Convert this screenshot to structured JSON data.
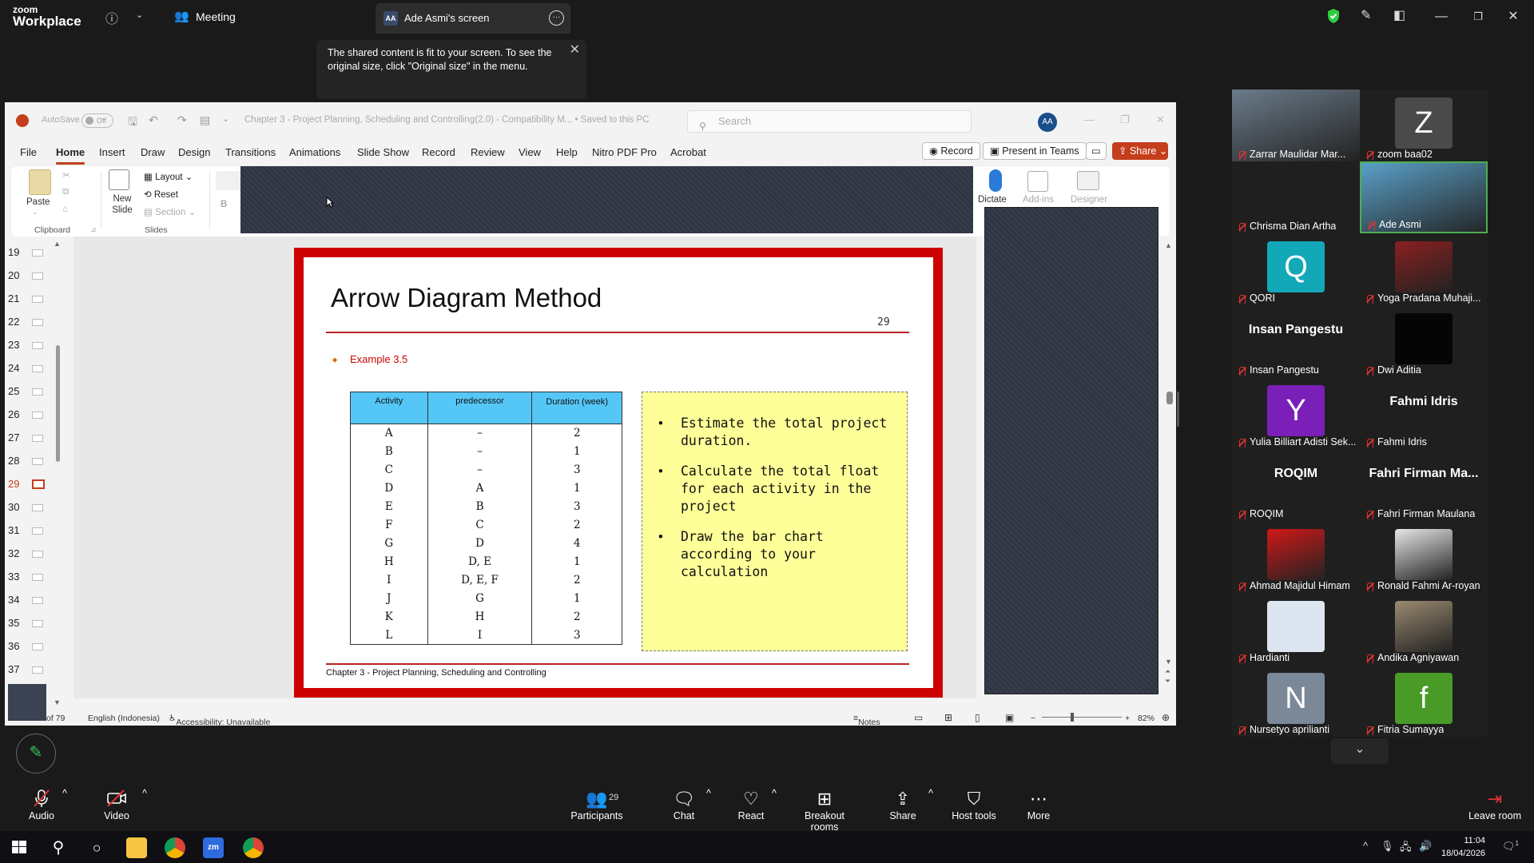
{
  "zoom": {
    "logo_line1": "zoom",
    "logo_line2": "Workplace",
    "meeting_label": "Meeting",
    "screen_tab_badge": "AA",
    "screen_tab_title": "Ade Asmi's screen",
    "tooltip_text": "The shared content is fit to your screen. To see the original size, click \"Original size\" in the menu."
  },
  "ppt": {
    "autosave_label": "AutoSave",
    "autosave_state": "Off",
    "doc_title": "Chapter 3 - Project Planning, Scheduling and Controlling(2.0) - Compatibility M... • Saved to this PC",
    "search_placeholder": "Search",
    "avatar": "AA",
    "tabs": [
      "File",
      "Home",
      "Insert",
      "Draw",
      "Design",
      "Transitions",
      "Animations",
      "Slide Show",
      "Record",
      "Review",
      "View",
      "Help",
      "Nitro PDF Pro",
      "Acrobat"
    ],
    "record_btn": "Record",
    "teams_btn": "Present in Teams",
    "share_btn": "Share",
    "ribbon": {
      "paste": "Paste",
      "clipboard": "Clipboard",
      "new_slide": "New Slide",
      "layout": "Layout",
      "reset": "Reset",
      "section": "Section",
      "slides": "Slides",
      "bold": "B",
      "dictate": "Dictate",
      "addins": "Add-ins",
      "designer": "Designer"
    },
    "thumbnails": [
      "19",
      "20",
      "21",
      "22",
      "23",
      "24",
      "25",
      "26",
      "27",
      "28",
      "29",
      "30",
      "31",
      "32",
      "33",
      "34",
      "35",
      "36",
      "37"
    ],
    "status": {
      "slide_count": "of 79",
      "language": "English (Indonesia)",
      "accessibility": "Accessibility: Unavailable",
      "notes": "Notes",
      "zoom": "82%"
    }
  },
  "slide": {
    "title": "Arrow Diagram Method",
    "page_number": "29",
    "example": "Example 3.5",
    "table": {
      "headers": [
        "Activity",
        "predecessor",
        "Duration (week)"
      ],
      "rows": [
        [
          "A",
          "–",
          "2"
        ],
        [
          "B",
          "–",
          "1"
        ],
        [
          "C",
          "–",
          "3"
        ],
        [
          "D",
          "A",
          "1"
        ],
        [
          "E",
          "B",
          "3"
        ],
        [
          "F",
          "C",
          "2"
        ],
        [
          "G",
          "D",
          "4"
        ],
        [
          "H",
          "D, E",
          "1"
        ],
        [
          "I",
          "D, E, F",
          "2"
        ],
        [
          "J",
          "G",
          "1"
        ],
        [
          "K",
          "H",
          "2"
        ],
        [
          "L",
          "I",
          "3"
        ]
      ]
    },
    "tasks": [
      "Estimate the total project duration.",
      "Calculate the total float for each activity in the project",
      "Draw the bar chart according to your calculation"
    ],
    "footer": "Chapter 3 - Project Planning, Scheduling and Controlling"
  },
  "participants": [
    {
      "name": "Zarrar Maulidar Mar...",
      "type": "video",
      "color": "#6b7b8a"
    },
    {
      "name": "zoom baa02",
      "type": "avatar",
      "letter": "Z",
      "color": "#4a4a4a"
    },
    {
      "name": "Chrisma Dian Artha",
      "type": "blank",
      "color": "#1f1f1f"
    },
    {
      "name": "Ade Asmi",
      "type": "video",
      "color": "#5aa0c8"
    },
    {
      "name": "QORI",
      "type": "avatar",
      "letter": "Q",
      "color": "#13a8b8"
    },
    {
      "name": "Yoga Pradana Muhaji...",
      "type": "video",
      "color": "#8a2020"
    },
    {
      "name": "Insan Pangestu",
      "type": "text",
      "big": "Insan Pangestu"
    },
    {
      "name": "Dwi Aditia",
      "type": "avatar",
      "letter": "",
      "color": "#050505"
    },
    {
      "name": "Yulia Billiart Adisti Sek...",
      "type": "avatar",
      "letter": "Y",
      "color": "#7a1fb8"
    },
    {
      "name": "Fahmi Idris",
      "type": "text",
      "big": "Fahmi Idris"
    },
    {
      "name": "ROQIM",
      "type": "text",
      "big": "ROQIM"
    },
    {
      "name": "Fahri Firman Maulana",
      "type": "text",
      "big": "Fahri Firman Ma..."
    },
    {
      "name": "Ahmad Majidul Himam",
      "type": "video",
      "color": "#d01818"
    },
    {
      "name": "Ronald Fahmi Ar-royan",
      "type": "video",
      "color": "#e6e6e6"
    },
    {
      "name": "Hardianti",
      "type": "avatar",
      "letter": "",
      "color": "#dce6f0"
    },
    {
      "name": "Andika Agniyawan",
      "type": "video",
      "color": "#9a8a70"
    },
    {
      "name": "Nursetyo aprilianti",
      "type": "avatar",
      "letter": "N",
      "color": "#7a8898"
    },
    {
      "name": "Fitria Sumayya",
      "type": "avatar",
      "letter": "f",
      "color": "#4a9a28"
    }
  ],
  "toolbar": {
    "audio": "Audio",
    "video": "Video",
    "participants": "Participants",
    "participants_count": "29",
    "chat": "Chat",
    "react": "React",
    "breakout": "Breakout rooms",
    "share": "Share",
    "host_tools": "Host tools",
    "more": "More",
    "leave": "Leave room"
  },
  "taskbar": {
    "time": "11:04",
    "date": "18/04/2026",
    "notif_count": "1"
  },
  "colors": {
    "ppt_accent": "#c43e1c",
    "slide_border": "#cc0000",
    "table_header": "#55c7f6",
    "task_box": "#ffff99",
    "speaker_border": "#4caf50"
  }
}
